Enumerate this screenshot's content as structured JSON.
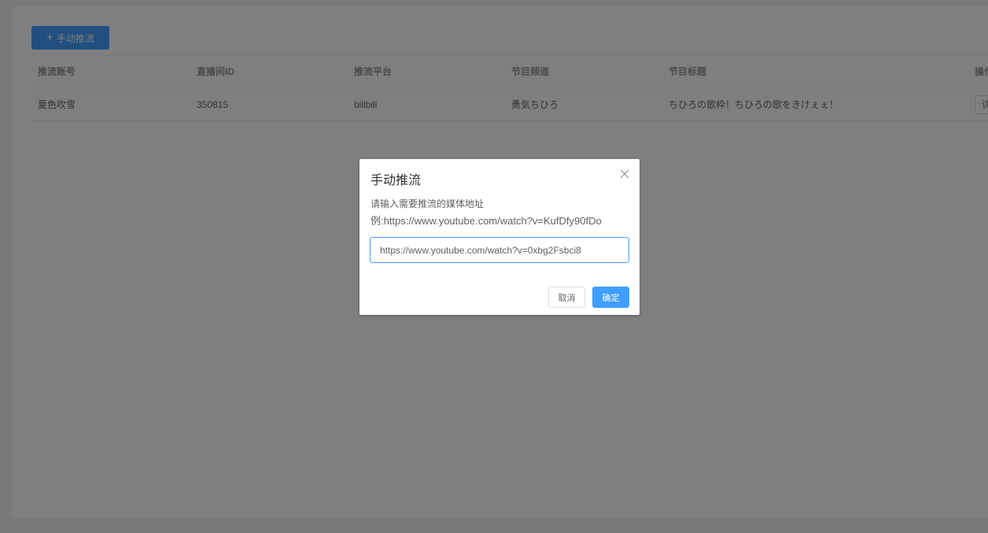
{
  "toolbar": {
    "add_icon": "plus-icon",
    "add_label": "手动推流"
  },
  "table": {
    "headers": [
      "推流账号",
      "直播间ID",
      "推流平台",
      "节目频道",
      "节目标题",
      "操作"
    ],
    "rows": [
      {
        "account": "夏色吹雪",
        "room_id": "350815",
        "platform": "bilibili",
        "channel": "勇気ちひろ",
        "title": "ちひろの歌枠！ちひろの歌をきけぇぇ！",
        "action": "详"
      }
    ]
  },
  "dialog": {
    "title": "手动推流",
    "close_icon": "close-icon",
    "prompt": "请输入需要推流的媒体地址",
    "example": "例:https://www.youtube.com/watch?v=KufDfy90fDo",
    "input_value": "https://www.youtube.com/watch?v=0xbg2Fsbci8",
    "cancel_label": "取消",
    "confirm_label": "确定"
  },
  "colors": {
    "primary": "#409eff",
    "mask": "rgba(0,0,0,0.5)"
  }
}
